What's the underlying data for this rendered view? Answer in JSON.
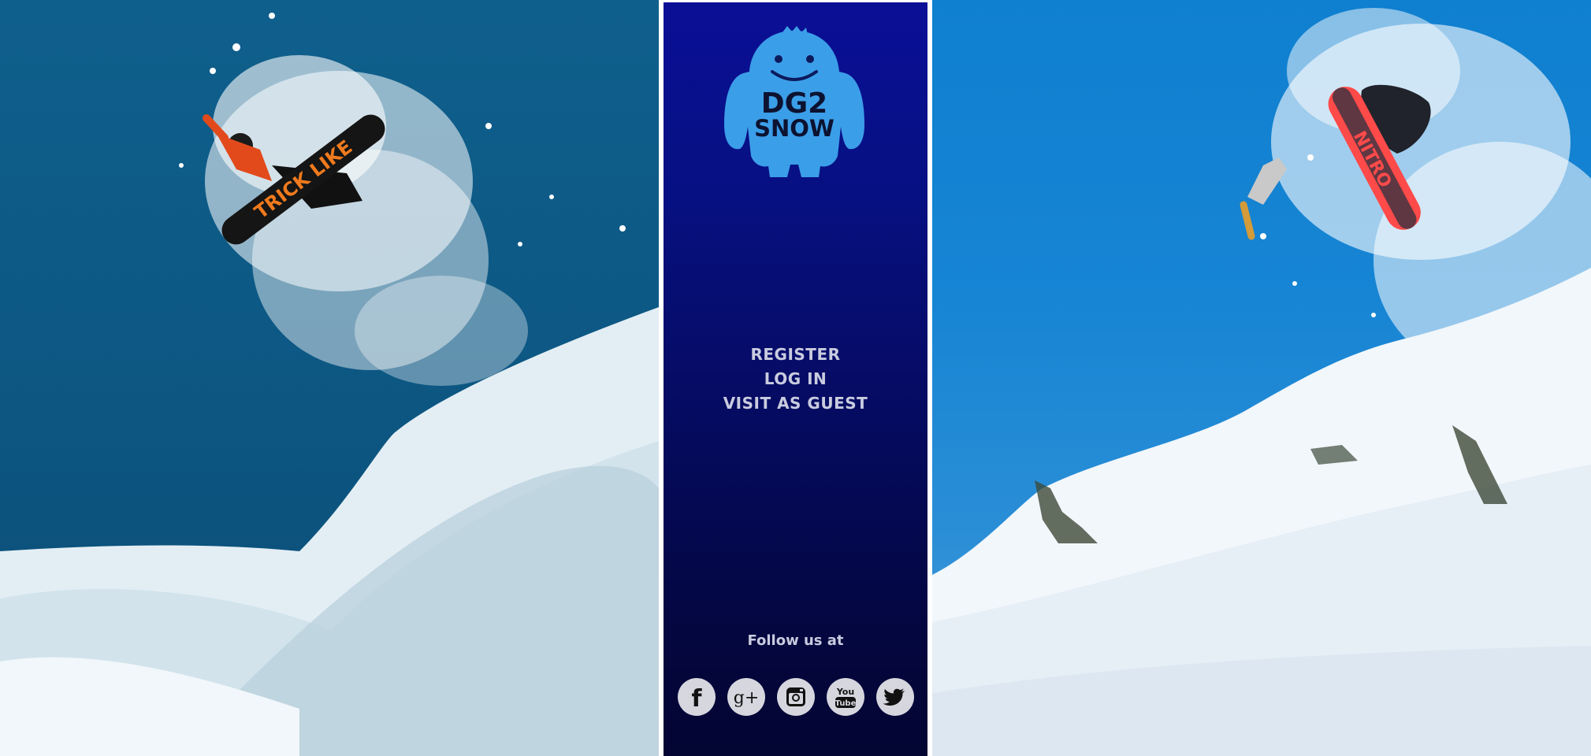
{
  "brand": {
    "logo_line1": "DG2",
    "logo_line2": "SNOW"
  },
  "nav": {
    "register": "REGISTER",
    "login": "LOG IN",
    "guest": "VISIT AS GUEST"
  },
  "social": {
    "heading": "Follow us at",
    "items": [
      {
        "name": "facebook-icon",
        "glyph": "f"
      },
      {
        "name": "google-plus-icon",
        "glyph": "g+"
      },
      {
        "name": "instagram-icon",
        "glyph": ""
      },
      {
        "name": "youtube-icon",
        "glyph_top": "You",
        "glyph_bottom": "Tube"
      },
      {
        "name": "twitter-icon",
        "glyph": ""
      }
    ]
  },
  "colors": {
    "panel_top": "#0a0f96",
    "panel_bottom": "#030532",
    "mascot": "#3b9ee8",
    "text": "#c9ccdf",
    "icon_bg": "#d6d6de"
  },
  "boards": {
    "left_graphic": "TRICK LIKE",
    "right_graphic": "NITRO"
  }
}
